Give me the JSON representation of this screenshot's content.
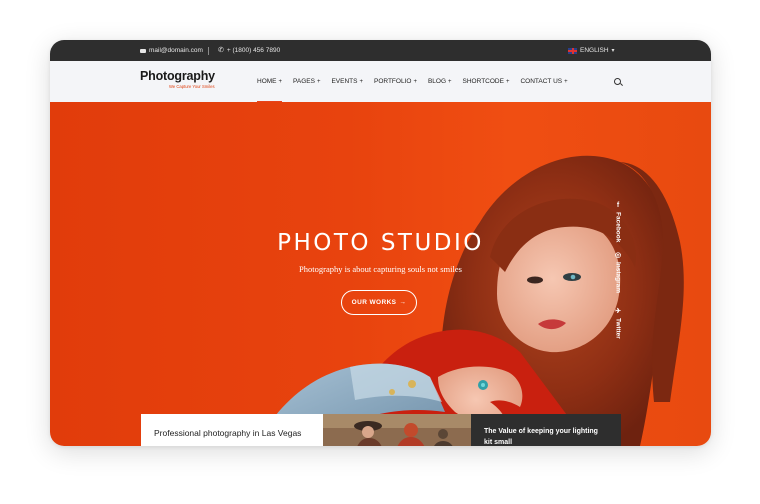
{
  "topbar": {
    "email": "mail@domain.com",
    "phone": "+ (1800) 456 7890",
    "language": "ENGLISH"
  },
  "logo": {
    "title": "Photography",
    "tagline": "We Capture Your Smiles"
  },
  "nav": {
    "items": [
      {
        "label": "HOME"
      },
      {
        "label": "PAGES"
      },
      {
        "label": "EVENTS"
      },
      {
        "label": "PORTFOLIO"
      },
      {
        "label": "BLOG"
      },
      {
        "label": "SHORTCODE"
      },
      {
        "label": "CONTACT US"
      }
    ],
    "plus": "+"
  },
  "hero": {
    "title": "PHOTO STUDIO",
    "subtitle": "Photography is about capturing souls not smiles",
    "button_label": "OUR WORKS",
    "button_arrow": "→"
  },
  "social": [
    {
      "label": "Facebook",
      "icon": "facebook-icon",
      "glyph": "f"
    },
    {
      "label": "Instagram",
      "icon": "instagram-icon",
      "glyph": "◎"
    },
    {
      "label": "Twitter",
      "icon": "twitter-icon",
      "glyph": "✈"
    }
  ],
  "cards": {
    "left_title": "Professional photography in Las Vegas",
    "right_title": "The Value of keeping your lighting kit small"
  },
  "colors": {
    "accent": "#e8431b",
    "hero_bg": "#e8430e",
    "topbar_bg": "#2e2e2e",
    "card_dark": "#2e2e2e"
  }
}
